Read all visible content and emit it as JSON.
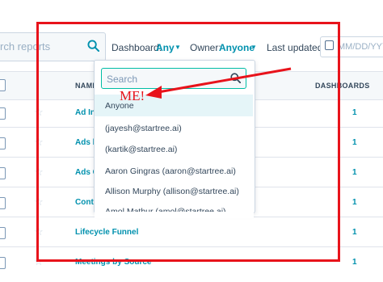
{
  "toolbar": {
    "search_placeholder": "rch reports",
    "dashboard_label": "Dashboard:",
    "dashboard_value": "Any",
    "owner_label": "Owner:",
    "owner_value": "Anyone",
    "last_updated_label": "Last updated:",
    "date_placeholder": "MM/DD/YYY"
  },
  "table": {
    "headers": {
      "name": "NAME",
      "dashboards": "DASHBOARDS"
    },
    "rows": [
      {
        "name": "Ad In",
        "dashboards": "1"
      },
      {
        "name": "Ads b",
        "dashboards": "1"
      },
      {
        "name": "Ads C",
        "dashboards": "1"
      },
      {
        "name": "Conto",
        "dashboards": "1"
      },
      {
        "name": "Lifecycle Funnel",
        "dashboards": "1"
      },
      {
        "name": "Meetings by Source",
        "dashboards": "1"
      }
    ]
  },
  "owner_dropdown": {
    "search_placeholder": "Search",
    "items": [
      "Anyone",
      "(jayesh@startree.ai)",
      "(kartik@startree.ai)",
      "Aaron Gingras (aaron@startree.ai)",
      "Allison Murphy (allison@startree.ai)",
      "Amol Mathur (amol@startree.ai)"
    ],
    "selected_index": 0
  },
  "annotation": {
    "text": "ME!",
    "color": "#e8131b"
  },
  "colors": {
    "link": "#0091ae",
    "text": "#33475b",
    "focus": "#00bda5",
    "selected_bg": "#e5f5f8"
  }
}
